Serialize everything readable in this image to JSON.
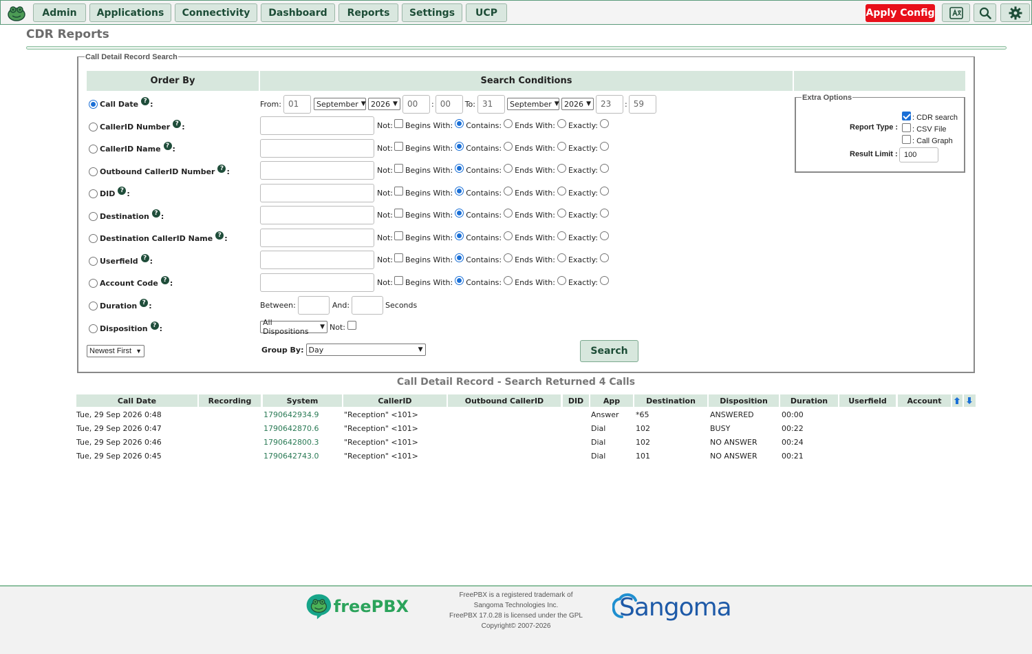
{
  "nav": {
    "items": [
      "Admin",
      "Applications",
      "Connectivity",
      "Dashboard",
      "Reports",
      "Settings",
      "UCP"
    ],
    "apply_config": "Apply Config"
  },
  "page": {
    "title": "CDR Reports"
  },
  "search": {
    "legend": "Call Detail Record Search",
    "order_by_header": "Order By",
    "conditions_header": "Search Conditions",
    "help_glyph": "?",
    "order_fields": [
      {
        "label": "Call Date",
        "checked": true
      },
      {
        "label": "CallerID Number",
        "checked": false
      },
      {
        "label": "CallerID Name",
        "checked": false
      },
      {
        "label": "Outbound CallerID Number",
        "checked": false
      },
      {
        "label": "DID",
        "checked": false
      },
      {
        "label": "Destination",
        "checked": false
      },
      {
        "label": "Destination CallerID Name",
        "checked": false
      },
      {
        "label": "Userfield",
        "checked": false
      },
      {
        "label": "Account Code",
        "checked": false
      },
      {
        "label": "Duration",
        "checked": false
      },
      {
        "label": "Disposition",
        "checked": false
      }
    ],
    "date_range": {
      "from_label": "From:",
      "from_day": "01",
      "from_month": "September",
      "from_year": "2026",
      "from_hour": "00",
      "from_min": "00",
      "to_label": "To:",
      "to_day": "31",
      "to_month": "September",
      "to_year": "2026",
      "to_hour": "23",
      "to_min": "59",
      "time_sep": ":"
    },
    "match_labels": {
      "not": "Not:",
      "begins": "Begins With:",
      "contains": "Contains:",
      "ends": "Ends With:",
      "exactly": "Exactly:"
    },
    "duration": {
      "between": "Between:",
      "and": "And:",
      "unit": "Seconds"
    },
    "disposition": {
      "selected": "All Dispositions",
      "not": "Not:"
    },
    "sort_order": "Newest First",
    "group_by": {
      "label": "Group By:",
      "selected": "Day"
    },
    "search_button": "Search"
  },
  "extra_options": {
    "legend": "Extra Options",
    "report_type_label": "Report Type :",
    "types": [
      {
        "label": ": CDR search",
        "checked": true
      },
      {
        "label": ": CSV File",
        "checked": false
      },
      {
        "label": ": Call Graph",
        "checked": false
      }
    ],
    "result_limit_label": "Result Limit :",
    "result_limit": "100"
  },
  "results": {
    "title": "Call Detail Record - Search Returned 4 Calls",
    "columns": [
      "Call Date",
      "Recording",
      "System",
      "CallerID",
      "Outbound CallerID",
      "DID",
      "App",
      "Destination",
      "Disposition",
      "Duration",
      "Userfield",
      "Account"
    ],
    "rows": [
      {
        "call_date": "Tue, 29 Sep 2026 0:48",
        "system": "1790642934.9",
        "callerid": "\"Reception\" <101>",
        "app": "Answer",
        "destination": "*65",
        "disposition": "ANSWERED",
        "duration": "00:00"
      },
      {
        "call_date": "Tue, 29 Sep 2026 0:47",
        "system": "1790642870.6",
        "callerid": "\"Reception\" <101>",
        "app": "Dial",
        "destination": "102",
        "disposition": "BUSY",
        "duration": "00:22"
      },
      {
        "call_date": "Tue, 29 Sep 2026 0:46",
        "system": "1790642800.3",
        "callerid": "\"Reception\" <101>",
        "app": "Dial",
        "destination": "102",
        "disposition": "NO ANSWER",
        "duration": "00:24"
      },
      {
        "call_date": "Tue, 29 Sep 2026 0:45",
        "system": "1790642743.0",
        "callerid": "\"Reception\" <101>",
        "app": "Dial",
        "destination": "101",
        "disposition": "NO ANSWER",
        "duration": "00:21"
      }
    ]
  },
  "footer": {
    "freepbx_logo": "freePBX",
    "lines": [
      "FreePBX is a registered trademark of",
      "Sangoma Technologies Inc.",
      "FreePBX 17.0.28 is licensed under the GPL",
      "Copyright© 2007-2026"
    ],
    "sangoma_logo": "Sangoma"
  },
  "colors": {
    "accent_green": "#d7e7dd",
    "brand_dark": "#1d4d37",
    "apply_red": "#e8101a",
    "link": "#2a7a55"
  }
}
